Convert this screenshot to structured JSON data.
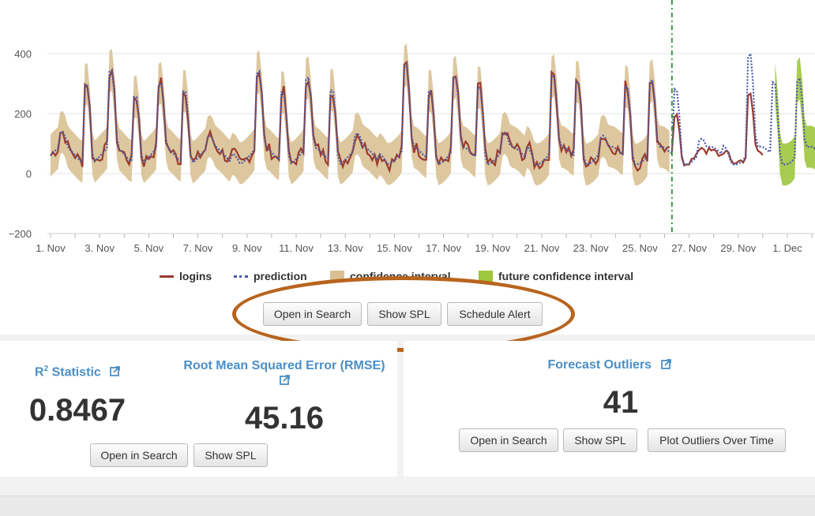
{
  "chart": {
    "legend": [
      {
        "label": "logins",
        "color": "#9b3b2e",
        "kind": "line"
      },
      {
        "label": "prediction",
        "color": "#4a5aa8",
        "kind": "dots"
      },
      {
        "label": "confidence interval",
        "color": "#d9c193",
        "kind": "box"
      },
      {
        "label": "future confidence interval",
        "color": "#9ec73d",
        "kind": "box"
      }
    ],
    "buttons": {
      "open_in_search": "Open in Search",
      "show_spl": "Show SPL",
      "schedule_alert": "Schedule Alert"
    }
  },
  "chart_data": {
    "type": "line",
    "x_ticks": [
      "1. Nov",
      "3. Nov",
      "5. Nov",
      "7. Nov",
      "9. Nov",
      "11. Nov",
      "13. Nov",
      "15. Nov",
      "17. Nov",
      "19. Nov",
      "21. Nov",
      "23. Nov",
      "25. Nov",
      "27. Nov",
      "29. Nov",
      "1. Dec"
    ],
    "y_ticks": [
      "400",
      "200",
      "0",
      "−200"
    ],
    "ylim": [
      -200,
      500
    ],
    "forecast_start_day": 25.3,
    "daily_peaks": [
      80,
      440,
      420,
      370,
      350,
      400,
      60,
      50,
      415,
      390,
      385,
      400,
      80,
      40,
      460,
      390,
      395,
      405,
      90,
      70,
      410,
      430,
      80,
      400,
      390,
      380,
      70,
      60,
      540,
      410
    ],
    "logins_end_day": 29.1,
    "grid": true,
    "series": [
      {
        "name": "logins"
      },
      {
        "name": "prediction"
      },
      {
        "name": "confidence interval"
      },
      {
        "name": "future confidence interval"
      }
    ]
  },
  "left_panel": {
    "r2": {
      "title": "R",
      "title_sup": "2",
      "title_rest": " Statistic",
      "value": "0.8467"
    },
    "rmse": {
      "title": "Root Mean Squared Error (RMSE)",
      "value": "45.16"
    },
    "buttons": {
      "open_in_search": "Open in Search",
      "show_spl": "Show SPL"
    }
  },
  "right_panel": {
    "title": "Forecast Outliers",
    "value": "41",
    "buttons": {
      "open_in_search": "Open in Search",
      "show_spl": "Show SPL",
      "plot_outliers": "Plot Outliers Over Time"
    }
  },
  "colors": {
    "accent_link": "#4a8fc6",
    "logins": "#9b3b2e",
    "prediction": "#4a5aa8",
    "confidence": "#d9c193",
    "future_confidence": "#9ec73d",
    "forecast_divider": "#3a9a3a",
    "highlight": "#b8641e"
  },
  "icons": {
    "external_link": "external-link-icon"
  }
}
